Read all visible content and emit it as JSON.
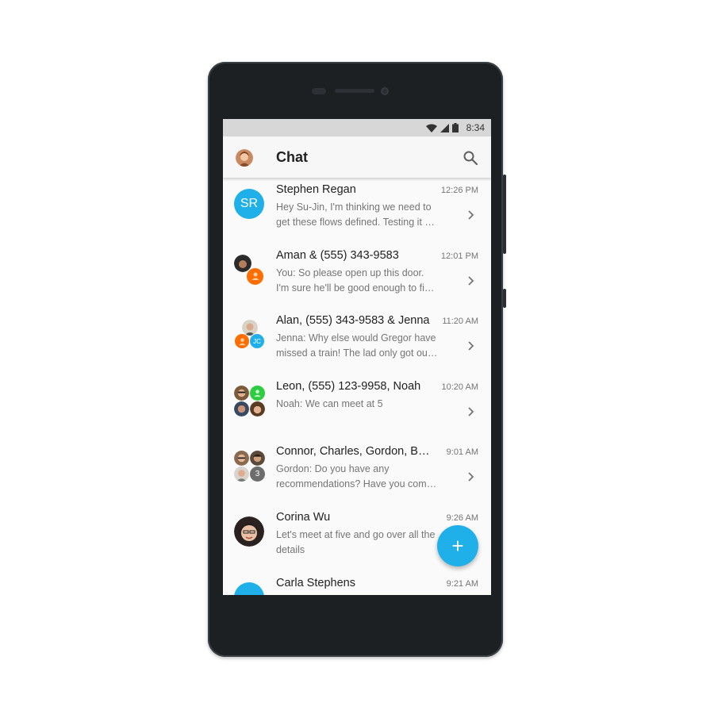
{
  "status_bar": {
    "time": "8:34"
  },
  "app_bar": {
    "title": "Chat"
  },
  "colors": {
    "accent": "#1fb0ea",
    "orange": "#ff6d00",
    "green": "#2ecc40",
    "gray": "#6d6d6d"
  },
  "conversations": [
    {
      "name": "Stephen Regan",
      "time": "12:26 PM",
      "preview": "Hey Su-Jin, I'm thinking we need to get these flows defined. Testing it out with real users",
      "avatar_initials": "SR"
    },
    {
      "name": "Aman & (555) 343-9583",
      "time": "12:01 PM",
      "preview": "You: So please open up this door. I'm sure he'll be good enough to find a seat"
    },
    {
      "name": "Alan, (555) 343-9583 & Jenna",
      "time": "11:20 AM",
      "preview": "Jenna: Why else would Gregor have missed a train! The lad only got out of the army",
      "avatar_initials": "JC"
    },
    {
      "name": "Leon, (555) 123-9958, Noah",
      "time": "10:20 AM",
      "preview": "Noah: We can meet at 5"
    },
    {
      "name": "Connor, Charles, Gordon, Brian",
      "time": "9:01 AM",
      "preview": "Gordon: Do you have any recommendations? Have you come across anything",
      "avatar_count": "3"
    },
    {
      "name": "Corina Wu",
      "time": "9:26 AM",
      "preview": "Let's meet at five and go over all the details"
    },
    {
      "name": "Carla Stephens",
      "time": "9:21 AM",
      "preview": ""
    }
  ],
  "fab": {
    "icon": "plus-icon",
    "label": "+"
  }
}
